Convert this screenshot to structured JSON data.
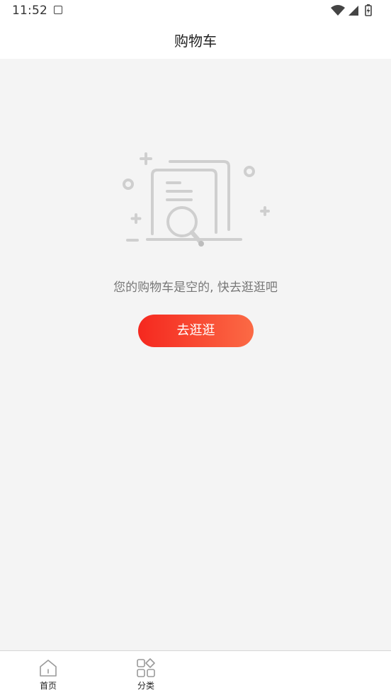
{
  "status_bar": {
    "time": "11:52",
    "notification_icon": "a-badge-icon",
    "icons": [
      "wifi-icon",
      "signal-icon",
      "battery-charging-icon"
    ]
  },
  "header": {
    "title": "购物车"
  },
  "empty_state": {
    "illustration_icon": "empty-document-search-icon",
    "message": "您的购物车是空的, 快去逛逛吧",
    "button_label": "去逛逛",
    "button_colors": [
      "#f5281f",
      "#fb6a45"
    ]
  },
  "bottom_nav": {
    "items": [
      {
        "label": "首页",
        "icon": "home-icon"
      },
      {
        "label": "分类",
        "icon": "category-grid-icon"
      }
    ]
  }
}
